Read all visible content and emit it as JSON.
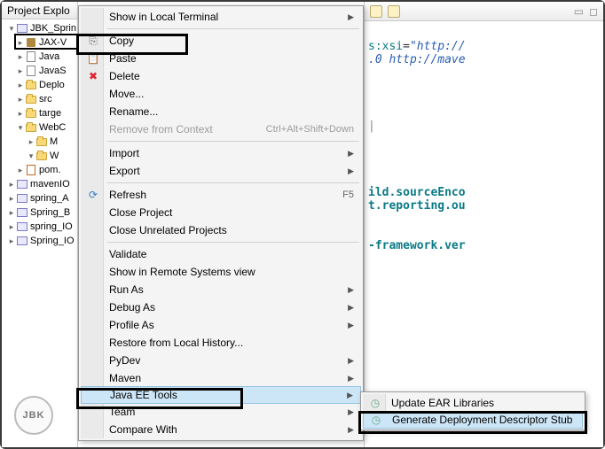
{
  "explorer": {
    "title": "Project Explo",
    "selected": "JBK_Sprin",
    "items": [
      {
        "lvl": 2,
        "icon": "pkg",
        "label": "JAX-V"
      },
      {
        "lvl": 2,
        "icon": "jfile",
        "label": "Java"
      },
      {
        "lvl": 2,
        "icon": "jfile",
        "label": "JavaS"
      },
      {
        "lvl": 2,
        "icon": "folder",
        "label": "Deplo"
      },
      {
        "lvl": 2,
        "icon": "folder",
        "label": "src"
      },
      {
        "lvl": 2,
        "icon": "folder",
        "label": "targe"
      },
      {
        "lvl": 2,
        "icon": "folder",
        "label": "WebC",
        "twisty": "▾"
      },
      {
        "lvl": 3,
        "icon": "folder",
        "label": "M",
        "twisty": "▸"
      },
      {
        "lvl": 3,
        "icon": "folder",
        "label": "W",
        "twisty": "▾"
      },
      {
        "lvl": 2,
        "icon": "xmlf",
        "label": "pom."
      },
      {
        "lvl": 1,
        "icon": "proj",
        "label": "mavenIO",
        "twisty": "▸"
      },
      {
        "lvl": 1,
        "icon": "proj",
        "label": "spring_A",
        "twisty": "▸"
      },
      {
        "lvl": 1,
        "icon": "proj",
        "label": "Spring_B",
        "twisty": "▸"
      },
      {
        "lvl": 1,
        "icon": "proj",
        "label": "spring_IO",
        "twisty": "▸"
      },
      {
        "lvl": 1,
        "icon": "proj",
        "label": "Spring_IO",
        "twisty": "▸"
      }
    ]
  },
  "logo": "JBK",
  "menu": {
    "items": [
      {
        "type": "item",
        "label": "Show in Local Terminal",
        "arrow": true
      },
      {
        "type": "sep"
      },
      {
        "type": "item",
        "label": "Copy",
        "icon": "copy"
      },
      {
        "type": "item",
        "label": "Paste",
        "icon": "paste"
      },
      {
        "type": "item",
        "label": "Delete",
        "icon": "del"
      },
      {
        "type": "item",
        "label": "Move..."
      },
      {
        "type": "item",
        "label": "Rename..."
      },
      {
        "type": "item",
        "label": "Remove from Context",
        "accel": "Ctrl+Alt+Shift+Down",
        "disabled": true
      },
      {
        "type": "sep"
      },
      {
        "type": "item",
        "label": "Import",
        "arrow": true
      },
      {
        "type": "item",
        "label": "Export",
        "arrow": true
      },
      {
        "type": "sep"
      },
      {
        "type": "item",
        "label": "Refresh",
        "icon": "refresh",
        "accel": "F5"
      },
      {
        "type": "item",
        "label": "Close Project"
      },
      {
        "type": "item",
        "label": "Close Unrelated Projects"
      },
      {
        "type": "sep"
      },
      {
        "type": "item",
        "label": "Validate"
      },
      {
        "type": "item",
        "label": "Show in Remote Systems view"
      },
      {
        "type": "item",
        "label": "Run As",
        "arrow": true
      },
      {
        "type": "item",
        "label": "Debug As",
        "arrow": true
      },
      {
        "type": "item",
        "label": "Profile As",
        "arrow": true
      },
      {
        "type": "item",
        "label": "Restore from Local History..."
      },
      {
        "type": "item",
        "label": "PyDev",
        "arrow": true
      },
      {
        "type": "item",
        "label": "Maven",
        "arrow": true
      },
      {
        "type": "item",
        "label": "Java EE Tools",
        "arrow": true,
        "hover": true
      },
      {
        "type": "item",
        "label": "Team",
        "arrow": true
      },
      {
        "type": "item",
        "label": "Compare With",
        "arrow": true
      }
    ]
  },
  "submenu": {
    "items": [
      {
        "label": "Update EAR Libraries"
      },
      {
        "label": "Generate Deployment Descriptor Stub",
        "hover": true
      }
    ]
  },
  "code": {
    "l1a": "s:xsi",
    "l1b": "=",
    "l1c": "\"http://",
    "l2": ".0 http://mave",
    "l3": "ild.sourceEnco",
    "l4": "t.reporting.ou",
    "l5": "-framework.ver"
  }
}
